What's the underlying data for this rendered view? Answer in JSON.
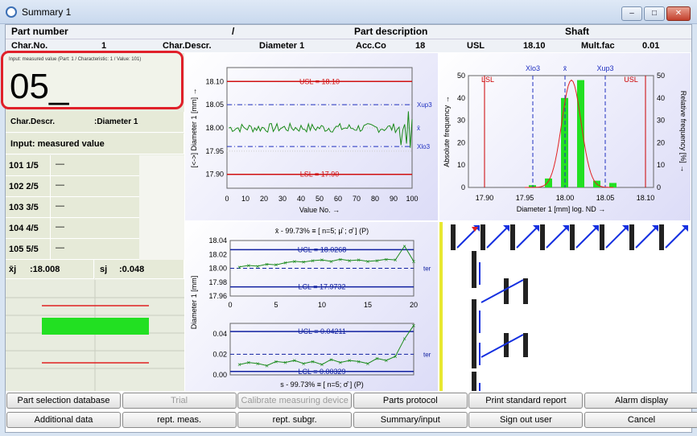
{
  "window": {
    "title": "Summary 1",
    "min": "–",
    "max": "□",
    "close": "✕"
  },
  "header": {
    "part_number_label": "Part number",
    "part_number_sep": "/",
    "part_description_label": "Part description",
    "part_description_value": "Shaft",
    "char_no_label": "Char.No.",
    "char_no_value": "1",
    "char_descr_label": "Char.Descr.",
    "char_descr_value": "Diameter 1",
    "acc_label": "Acc.Co",
    "acc_value": "18",
    "usl_label": "USL",
    "usl_value": "18.10",
    "mult_label": "Mult.faс",
    "mult_value": "0.01"
  },
  "input": {
    "caption": "Input: measured value (Part: 1 / Characteristic: 1 / Value: 101)",
    "value": "05_"
  },
  "left": {
    "char_descr_label": "Char.Descr.",
    "char_descr_value": ":Diameter 1",
    "input_label": "Input: measured value",
    "rows": [
      {
        "label": "101 1/5",
        "value": "—"
      },
      {
        "label": "102 2/5",
        "value": "—"
      },
      {
        "label": "103 3/5",
        "value": "—"
      },
      {
        "label": "104 4/5",
        "value": "—"
      },
      {
        "label": "105 5/5",
        "value": "—"
      }
    ],
    "xbar_label": "x̄j",
    "xbar_value": ":18.008",
    "s_label": "sj",
    "s_value": ":0.048"
  },
  "chart_data": [
    {
      "type": "line",
      "name": "value-chart",
      "ylabel": "[<->] Diameter 1 [mm] →",
      "xlabel": "Value No. →",
      "xlim": [
        0,
        100
      ],
      "ylim": [
        17.87,
        18.13
      ],
      "yticks": [
        "18.10",
        "18.05",
        "18.00",
        "17.95",
        "17.90"
      ],
      "xticks": [
        "0",
        "10",
        "20",
        "30",
        "40",
        "50",
        "60",
        "70",
        "80",
        "90",
        "100"
      ],
      "usl_label": "USL = 18.10",
      "lsl_label": "LSL = 17.90",
      "usl": 18.1,
      "lsl": 17.9,
      "xup3": 18.05,
      "xlo3": 17.96,
      "right_labels": [
        "Xup3",
        "x̄",
        "Xlo3"
      ]
    },
    {
      "type": "bar",
      "name": "histogram",
      "xlabel": "Diameter 1 [mm]  log. ND →",
      "ylabel": "Absolute frequency →",
      "y2label": "Relative frequency [%] →",
      "top_labels": [
        "LSL",
        "Xlo3",
        "x̄",
        "Xup3",
        "USL"
      ],
      "xticks": [
        "17.90",
        "17.95",
        "18.00",
        "18.05",
        "18.10"
      ],
      "yticks": [
        "0",
        "10",
        "20",
        "30",
        "40",
        "50"
      ],
      "categories": [
        17.96,
        17.98,
        18.0,
        18.02,
        18.04,
        18.06
      ],
      "values": [
        1,
        4,
        40,
        48,
        3,
        2
      ]
    },
    {
      "type": "line",
      "name": "xbar-chart",
      "title": "x̄ - 99.73% ≡ [ n=5; μ̂ ; σ̂ ] (P)",
      "ylabel": "Diameter 1 [mm]",
      "ucl_label": "UCL = 18.0268",
      "lcl_label": "LCL = 17.9732",
      "ucl": 18.0268,
      "lcl": 17.9732,
      "xlim": [
        0,
        20
      ],
      "ylim": [
        17.96,
        18.04
      ],
      "xticks": [
        "0",
        "5",
        "10",
        "15",
        "20"
      ],
      "yticks": [
        "18.04",
        "18.02",
        "18.00",
        "17.98",
        "17.96"
      ],
      "side_label": "ter",
      "values": [
        18.002,
        18.004,
        18.003,
        18.006,
        18.005,
        18.008,
        18.01,
        18.009,
        18.011,
        18.012,
        18.01,
        18.013,
        18.011,
        18.012,
        18.01,
        18.011,
        18.013,
        18.012,
        18.032,
        18.01
      ]
    },
    {
      "type": "line",
      "name": "s-chart",
      "title": "s - 99.73% ≡ [ n=5; σ̂ ] (P)",
      "ucl_label": "UCL = 0.04211",
      "lcl_label": "LCL = 0.00329",
      "ucl": 0.04211,
      "lcl": 0.00329,
      "ylim": [
        0,
        0.05
      ],
      "yticks": [
        "0.04",
        "0.02",
        "0.00"
      ],
      "side_label": "ter",
      "values": [
        0.01,
        0.012,
        0.011,
        0.009,
        0.013,
        0.012,
        0.014,
        0.011,
        0.013,
        0.01,
        0.015,
        0.012,
        0.014,
        0.013,
        0.011,
        0.016,
        0.014,
        0.018,
        0.035,
        0.048
      ]
    }
  ],
  "buttons": {
    "row1": [
      "Part selection database",
      "Trial",
      "Calibrate measuring device",
      "Parts protocol",
      "Print standard report",
      "Alarm display"
    ],
    "row2": [
      "Additional data",
      "rept. meas.",
      "rept. subgr.",
      "Summary/input",
      "Sign out user",
      "Cancel"
    ]
  }
}
